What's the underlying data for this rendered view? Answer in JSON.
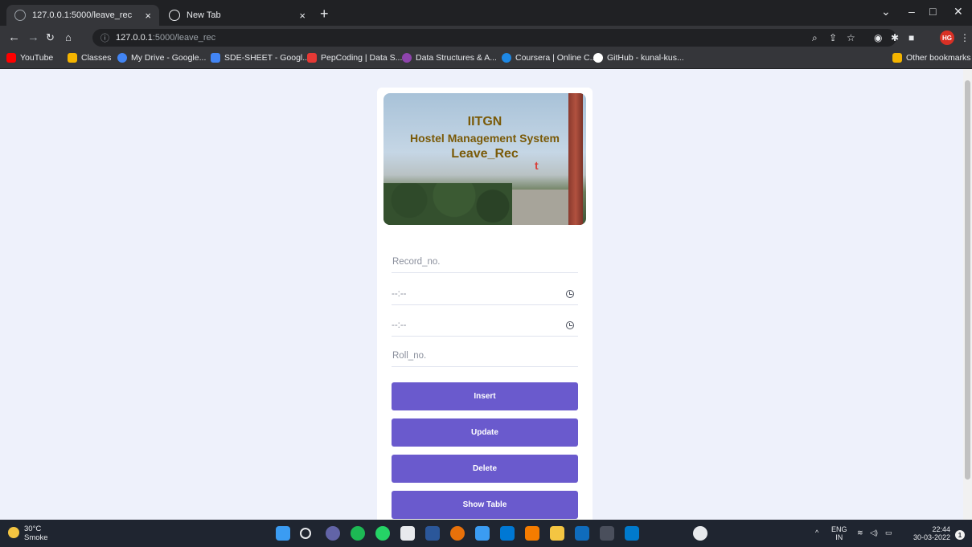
{
  "browser": {
    "tabs": [
      {
        "title": "127.0.0.1:5000/leave_rec",
        "active": true
      },
      {
        "title": "New Tab",
        "active": false
      }
    ],
    "new_tab_symbol": "+",
    "close_symbol": "×",
    "address": {
      "info_icon": "ⓘ",
      "host": "127.0.0.1",
      "path": ":5000/leave_rec"
    },
    "bookmarks": [
      {
        "label": "YouTube",
        "color": "#ff0000"
      },
      {
        "label": "Classes",
        "color": "#f4b400"
      },
      {
        "label": "My Drive - Google...",
        "color": "#4285f4"
      },
      {
        "label": "SDE-SHEET - Googl...",
        "color": "#4285f4"
      },
      {
        "label": "PepCoding | Data S...",
        "color": "#e53935"
      },
      {
        "label": "Data Structures & A...",
        "color": "#8e44ad"
      },
      {
        "label": "Coursera | Online C...",
        "color": "#1e88e5"
      },
      {
        "label": "GitHub - kunal-kus...",
        "color": "#ffffff"
      }
    ],
    "other_bookmarks": "Other bookmarks",
    "avatar_initials": "HG"
  },
  "banner": {
    "line1": "IITGN",
    "line2": "Hostel Management System",
    "line3": "Leave_Rec",
    "stray_letter": "t"
  },
  "form": {
    "record_no_placeholder": "Record_no.",
    "time1_value": "--:--",
    "time2_value": "--:--",
    "roll_no_placeholder": "Roll_no.",
    "buttons": {
      "insert": "Insert",
      "update": "Update",
      "delete": "Delete",
      "show_table": "Show Table"
    }
  },
  "taskbar": {
    "temperature": "30°C",
    "condition": "Smoke",
    "lang_top": "ENG",
    "lang_bottom": "IN",
    "time": "22:44",
    "date": "30-03-2022",
    "notification_count": "1"
  }
}
